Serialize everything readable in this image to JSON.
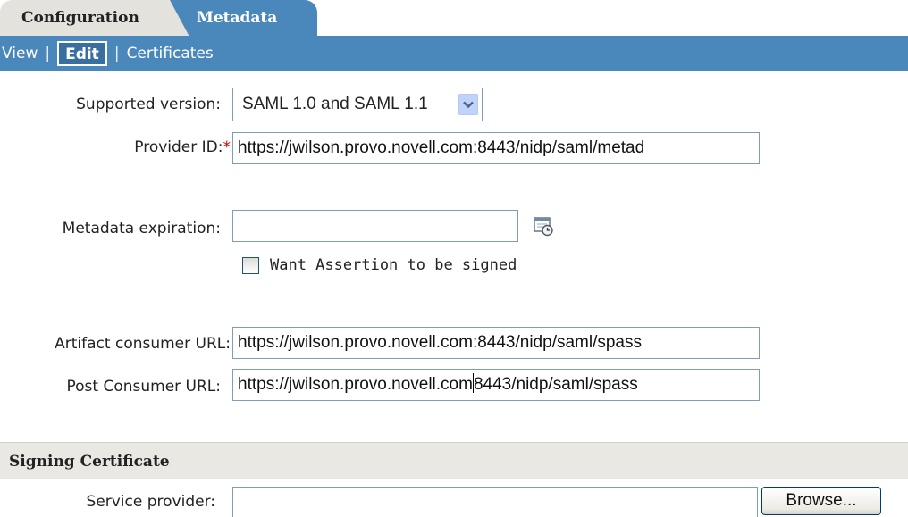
{
  "tabs": [
    {
      "label": "Configuration",
      "active": false
    },
    {
      "label": "Metadata",
      "active": true
    }
  ],
  "toolbar": {
    "view_label": "View",
    "edit_label": "Edit",
    "certificates_label": "Certificates",
    "separator": "|"
  },
  "form": {
    "supported_version": {
      "label": "Supported version:",
      "selected": "SAML 1.0 and SAML 1.1"
    },
    "provider_id": {
      "label": "Provider ID:",
      "required_mark": "*",
      "value": "https://jwilson.provo.novell.com:8443/nidp/saml/metad"
    },
    "metadata_expiration": {
      "label": "Metadata expiration:",
      "value": "",
      "icon": "calendar-clock-icon"
    },
    "want_assertion_signed": {
      "label": "Want Assertion to be signed",
      "checked": false
    },
    "artifact_consumer_url": {
      "label": "Artifact consumer URL:",
      "value": "https://jwilson.provo.novell.com:8443/nidp/saml/spass"
    },
    "post_consumer_url": {
      "label": "Post Consumer URL:",
      "value_before_caret": "https://jwilson.provo.novell.com",
      "value_after_caret": "8443/nidp/saml/spass"
    }
  },
  "signing_certificate": {
    "title": "Signing Certificate",
    "service_provider_label": "Service provider:",
    "service_provider_value": "",
    "browse_label": "Browse..."
  },
  "colors": {
    "accent_blue": "#4a88bc",
    "inactive_tab": "#e4e2dc",
    "required": "#cc0000"
  }
}
